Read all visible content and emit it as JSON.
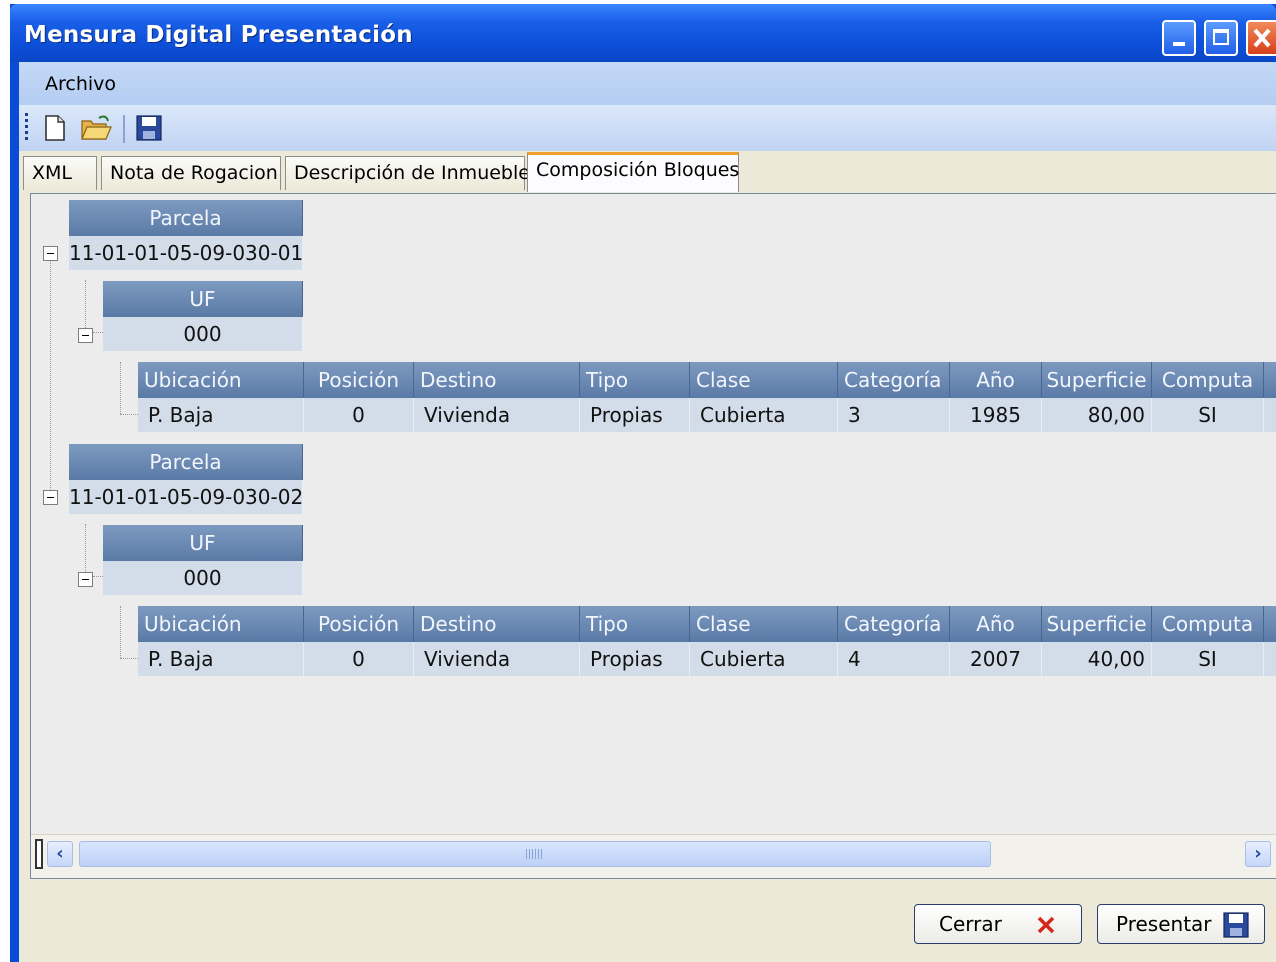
{
  "window": {
    "title": "Mensura Digital Presentación"
  },
  "menu": {
    "items": [
      {
        "label": "Archivo"
      }
    ]
  },
  "toolbar": {
    "icons": [
      "new-file-icon",
      "open-folder-icon",
      "save-icon"
    ]
  },
  "tabs": [
    {
      "label": "XML",
      "active": false
    },
    {
      "label": "Nota de Rogacion",
      "active": false
    },
    {
      "label": "Descripción de Inmuebles",
      "active": false
    },
    {
      "label": "Composición Bloques",
      "active": true
    }
  ],
  "grid": {
    "parcela_header": "Parcela",
    "uf_header": "UF",
    "columns": [
      "Ubicación",
      "Posición",
      "Destino",
      "Tipo",
      "Clase",
      "Categoría",
      "Año",
      "Superficie",
      "Computa"
    ],
    "parcelas": [
      {
        "id": "11-01-01-05-09-030-01",
        "uf": "000",
        "row": [
          "P. Baja",
          "0",
          "Vivienda",
          "Propias",
          "Cubierta",
          "3",
          "1985",
          "80,00",
          "SI"
        ]
      },
      {
        "id": "11-01-01-05-09-030-02",
        "uf": "000",
        "row": [
          "P. Baja",
          "0",
          "Vivienda",
          "Propias",
          "Cubierta",
          "4",
          "2007",
          "40,00",
          "SI"
        ]
      }
    ]
  },
  "buttons": {
    "cerrar": "Cerrar",
    "presentar": "Presentar"
  },
  "colors": {
    "titlebar": "#0d4fd8",
    "grid_header": "#6a88b3",
    "grid_row": "#d2dde9"
  }
}
